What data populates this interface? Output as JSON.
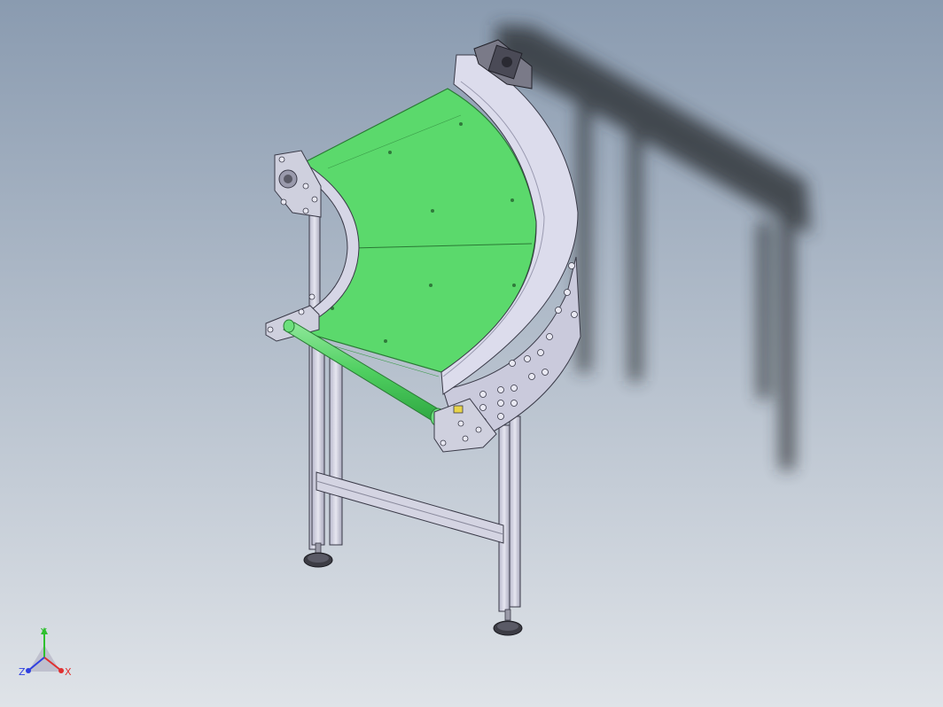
{
  "viewport": {
    "background_top": "#8a9bb0",
    "background_bottom": "#dfe3e8"
  },
  "model": {
    "belt_color": "#5bd96c",
    "frame_color": "#c9c9dd",
    "frame_edge_color": "#3a3a48",
    "shadow_color": "#2a2d33"
  },
  "triad": {
    "x_label": "X",
    "y_label": "Y",
    "z_label": "Z",
    "x_color": "#e03030",
    "y_color": "#30c030",
    "z_color": "#3040e0"
  }
}
